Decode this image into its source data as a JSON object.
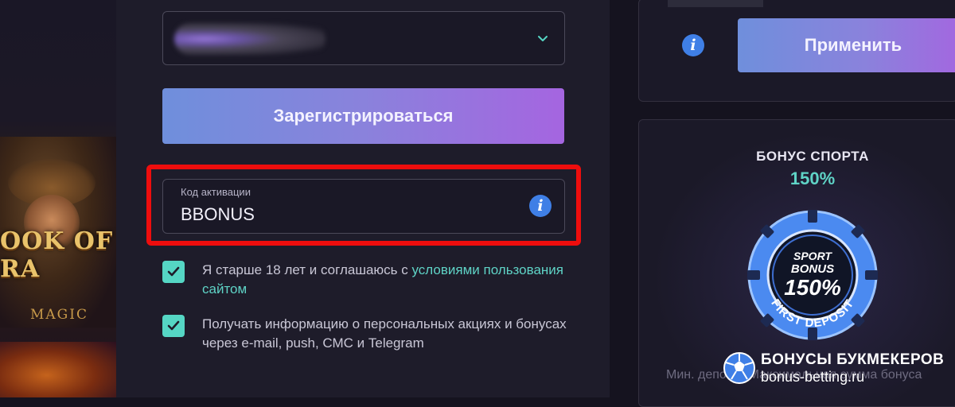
{
  "registration": {
    "register_button": "Зарегистрироваться",
    "activation_code": {
      "label": "Код активации",
      "value": "BBONUS"
    },
    "checkboxes": [
      {
        "text_before": "Я старше 18 лет и соглашаюсь с ",
        "link_text": "условиями пользования сайтом",
        "checked": true
      },
      {
        "text": "Получать информацию о персональных акциях и бонусах через e-mail, push, СМС и Telegram",
        "checked": true
      }
    ]
  },
  "promo": {
    "apply_button": "Применить"
  },
  "bonus_card": {
    "title": "БОНУС СПОРТА",
    "percent": "150%",
    "chip": {
      "line1": "SPORT",
      "line2": "BONUS",
      "big": "150%",
      "ring_text": "FIRST DEPOSIT"
    },
    "footer": "Мин. депозит   Максимальная сумма бонуса"
  },
  "left_game": {
    "title": "OOK OF RA",
    "subtitle": "MAGIC"
  },
  "watermark": {
    "line1": "БОНУСЫ БУКМЕКЕРОВ",
    "line2": "bonus-betting.ru"
  },
  "colors": {
    "accent_teal": "#5fd3c6",
    "info_blue": "#3f7fe6",
    "highlight_red": "#ee0d0d",
    "button_gradient_start": "#6f8fdc",
    "button_gradient_end": "#a565e0"
  },
  "icons": [
    "chevron-down-icon",
    "info-icon",
    "checkmark-icon",
    "soccer-ball-icon"
  ]
}
